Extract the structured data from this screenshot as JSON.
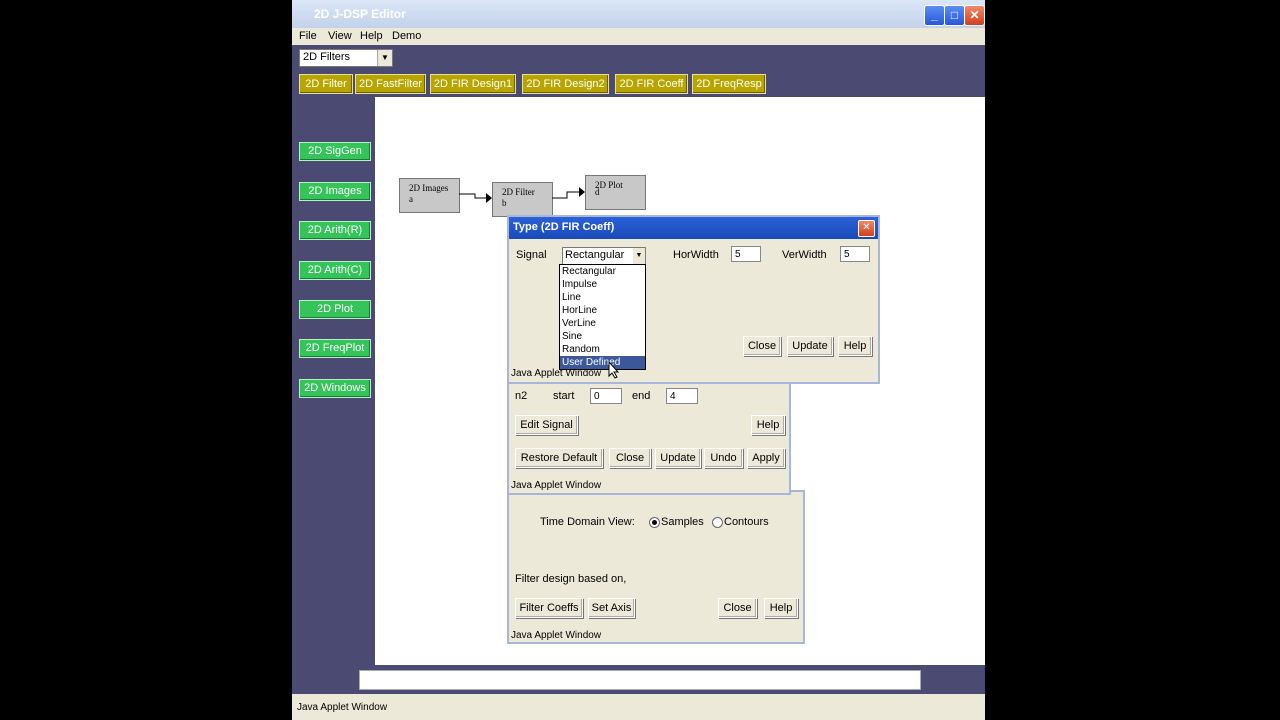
{
  "window": {
    "title": "2D J-DSP Editor",
    "minimize": "_",
    "maximize": "□",
    "close": "✕"
  },
  "menu": [
    "File",
    "View",
    "Help",
    "Demo"
  ],
  "toolbox_combo": {
    "value": "2D Filters"
  },
  "top_buttons": [
    "2D Filter",
    "2D FastFilter",
    "2D FIR Design1",
    "2D FIR Design2",
    "2D FIR Coeff",
    "2D FreqResp"
  ],
  "side_buttons": [
    "2D SigGen",
    "2D Images",
    "2D Arith(R)",
    "2D Arith(C)",
    "2D Plot",
    "2D FreqPlot",
    "2D Windows"
  ],
  "blocks": [
    {
      "name": "2D Images",
      "port": "a"
    },
    {
      "name": "2D Filter",
      "port": "b"
    },
    {
      "name": "2D Plot",
      "port": "d"
    }
  ],
  "type_dialog": {
    "title": "Type (2D FIR Coeff)",
    "signal_label": "Signal",
    "signal_value": "Rectangular",
    "horwidth_label": "HorWidth",
    "horwidth_value": "5",
    "verwidth_label": "VerWidth",
    "verwidth_value": "5",
    "options": [
      "Rectangular",
      "Impulse",
      "Line",
      "HorLine",
      "VerLine",
      "Sine",
      "Random",
      "User Defined"
    ],
    "selected_option": "User Defined",
    "close": "Close",
    "update": "Update",
    "help": "Help",
    "footer": "Java Applet Window"
  },
  "coeff_dialog": {
    "n2_label": "n2",
    "start_label": "start",
    "start_value": "0",
    "end_label": "end",
    "end_value": "4",
    "edit_signal": "Edit Signal",
    "help": "Help",
    "restore_default": "Restore Default",
    "close": "Close",
    "update": "Update",
    "undo": "Undo",
    "apply": "Apply",
    "footer": "Java Applet Window"
  },
  "filter_dialog": {
    "time_domain_label": "Time Domain View:",
    "samples": "Samples",
    "contours": "Contours",
    "filter_design_label": "Filter design based on,",
    "filter_coeffs": "Filter Coeffs",
    "set_axis": "Set Axis",
    "close": "Close",
    "help": "Help",
    "footer": "Java Applet Window"
  },
  "status_footer": "Java Applet Window"
}
